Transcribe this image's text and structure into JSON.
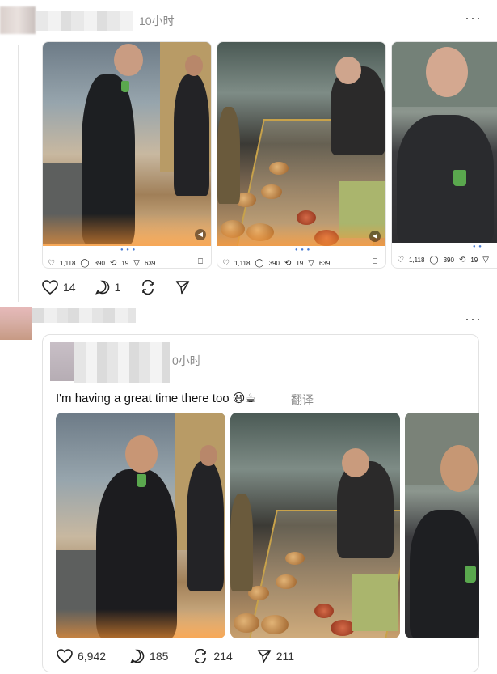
{
  "post1": {
    "time": "10小时",
    "more": "···",
    "media_stats": [
      {
        "likes": "1,118",
        "replies": "390",
        "reposts": "19",
        "shares": "639"
      },
      {
        "likes": "1,118",
        "replies": "390",
        "reposts": "19",
        "shares": "639"
      },
      {
        "likes": "1,118",
        "replies": "390",
        "reposts": "19"
      }
    ],
    "actions": {
      "likes": "14",
      "replies": "1"
    }
  },
  "post2": {
    "more": "···",
    "quote": {
      "time": "0小时",
      "text": "I'm having a great time there too 😆☕",
      "translate": "翻译"
    },
    "actions": {
      "likes": "6,942",
      "replies": "185",
      "reposts": "214",
      "shares": "211"
    }
  }
}
